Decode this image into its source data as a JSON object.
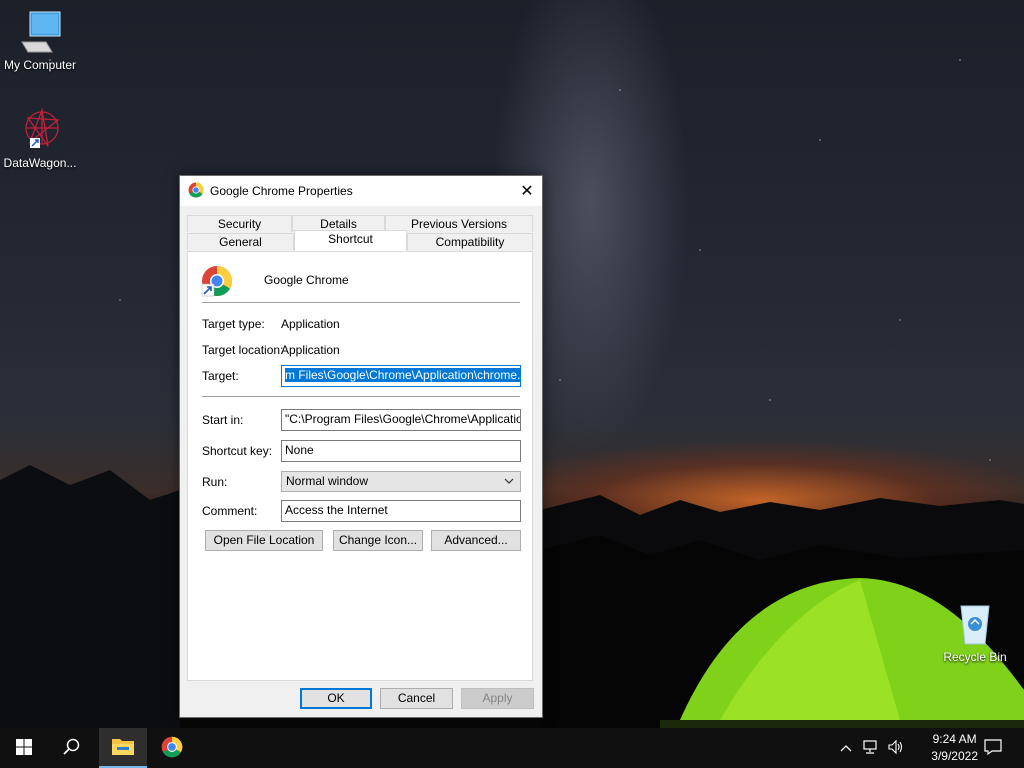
{
  "desktop": {
    "icons": [
      {
        "label": "My Computer"
      },
      {
        "label": "DataWagon..."
      },
      {
        "label": "Recycle Bin"
      }
    ]
  },
  "dialog": {
    "title": "Google Chrome Properties",
    "close_glyph": "✕",
    "tabs_top": [
      "Security",
      "Details",
      "Previous Versions"
    ],
    "tabs_bottom": [
      "General",
      "Shortcut",
      "Compatibility"
    ],
    "active_tab": "Shortcut",
    "app_name": "Google Chrome",
    "fields": {
      "target_type_label": "Target type:",
      "target_type_value": "Application",
      "target_location_label": "Target location:",
      "target_location_value": "Application",
      "target_label": "Target:",
      "target_value": "m Files\\Google\\Chrome\\Application\\chrome.exe\"",
      "start_in_label": "Start in:",
      "start_in_value": "\"C:\\Program Files\\Google\\Chrome\\Application\"",
      "shortcut_key_label": "Shortcut key:",
      "shortcut_key_value": "None",
      "run_label": "Run:",
      "run_value": "Normal window",
      "comment_label": "Comment:",
      "comment_value": "Access the Internet"
    },
    "buttons": {
      "open_file_location": "Open File Location",
      "change_icon": "Change Icon...",
      "advanced": "Advanced...",
      "ok": "OK",
      "cancel": "Cancel",
      "apply": "Apply"
    }
  },
  "taskbar": {
    "time": "9:24 AM",
    "date": "3/9/2022",
    "tray_chevron": "^"
  }
}
